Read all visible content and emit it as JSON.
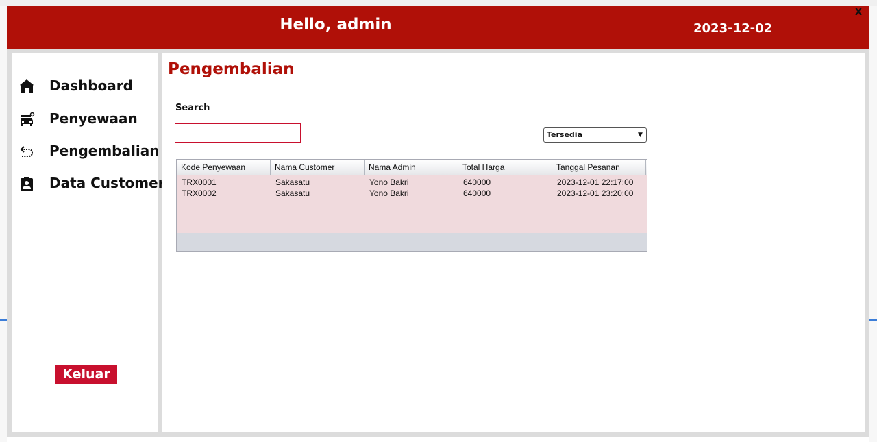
{
  "header": {
    "greeting": "Hello, admin",
    "date": "2023-12-02",
    "close_label": "X"
  },
  "sidebar": {
    "items": [
      {
        "label": "Dashboard",
        "icon": "home-icon"
      },
      {
        "label": "Penyewaan",
        "icon": "car-rental-icon"
      },
      {
        "label": "Pengembalian",
        "icon": "return-arrow-icon"
      },
      {
        "label": "Data Customer",
        "icon": "clipboard-user-icon"
      }
    ],
    "logout_label": "Keluar"
  },
  "main": {
    "title": "Pengembalian",
    "search_label": "Search",
    "search_value": "",
    "filter_selected": "Tersedia",
    "table": {
      "columns": [
        "Kode Penyewaan",
        "Nama Customer",
        "Nama Admin",
        "Total Harga",
        "Tanggal Pesanan"
      ],
      "rows": [
        [
          "TRX0001",
          "Sakasatu",
          "Yono Bakri",
          "640000",
          "2023-12-01 22:17:00"
        ],
        [
          "TRX0002",
          "Sakasatu",
          "Yono Bakri",
          "640000",
          "2023-12-01 23:20:00"
        ]
      ]
    }
  },
  "colors": {
    "header_red": "#b01008",
    "accent_red": "#c8102e",
    "table_row_bg": "#f0dadd"
  }
}
